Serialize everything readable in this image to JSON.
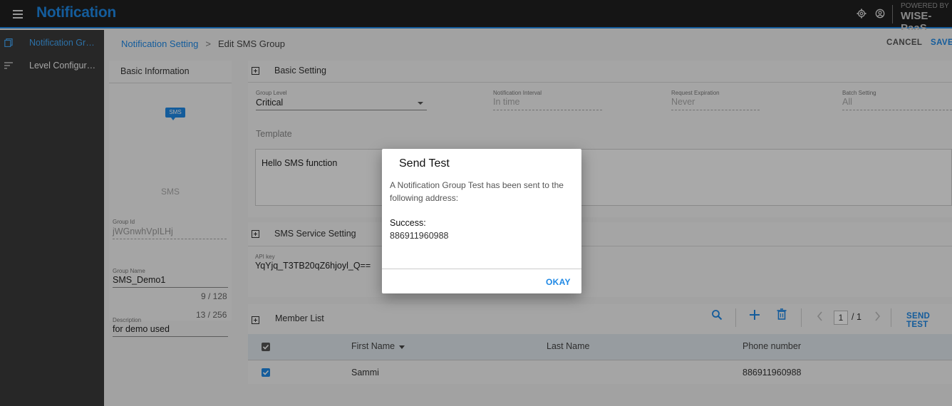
{
  "app": {
    "title": "Notification",
    "powered_by": "POWERED BY",
    "brand": "WISE-PaaS"
  },
  "sidebar": {
    "items": [
      {
        "label": "Notification Group Setting",
        "icon": "copy-icon",
        "active": true
      },
      {
        "label": "Level Configuration",
        "icon": "sort-lines-icon",
        "active": false
      }
    ]
  },
  "header": {
    "breadcrumb": {
      "parent": "Notification Setting",
      "separator": ">",
      "current": "Edit SMS Group"
    },
    "cancel_label": "CANCEL",
    "save_label": "SAVE"
  },
  "basic_info": {
    "title": "Basic Information",
    "icon_label": "SMS",
    "channel_name": "SMS",
    "group_id_label": "Group Id",
    "group_id_value": "jWGnwhVpILHj",
    "group_name_label": "Group Name",
    "group_name_value": "SMS_Demo1",
    "group_name_counter": "9 / 128",
    "description_label": "Description",
    "description_value": "for demo used",
    "description_counter": "13 / 256"
  },
  "basic_setting": {
    "title": "Basic Setting",
    "group_level_label": "Group Level",
    "group_level_value": "Critical",
    "interval_label": "Notification Interval",
    "interval_value": "In time",
    "expiration_label": "Request Expiration",
    "expiration_value": "Never",
    "batch_label": "Batch Setting",
    "batch_value": "All",
    "template_label": "Template",
    "template_value": "Hello SMS function"
  },
  "sms_service": {
    "title": "SMS Service Setting",
    "api_key_label": "API key",
    "api_key_value": "YqYjq_T3TB20qZ6hjoyl_Q=="
  },
  "member_list": {
    "title": "Member List",
    "page_current": "1",
    "page_total": "/ 1",
    "send_test_label": "SEND TEST",
    "columns": [
      "First Name",
      "Last Name",
      "Phone number"
    ],
    "rows": [
      {
        "first_name": "Sammi",
        "last_name": "",
        "phone": "886911960988",
        "checked": true
      }
    ]
  },
  "dialog": {
    "title": "Send Test",
    "message": "A Notification Group Test has been sent to the following address:",
    "success_label": "Success:",
    "phone": "886911960988",
    "okay_label": "OKAY"
  },
  "colors": {
    "accent": "#1e88e5",
    "topbar": "#1f1f1f",
    "sidebar": "#3a3a3a"
  }
}
